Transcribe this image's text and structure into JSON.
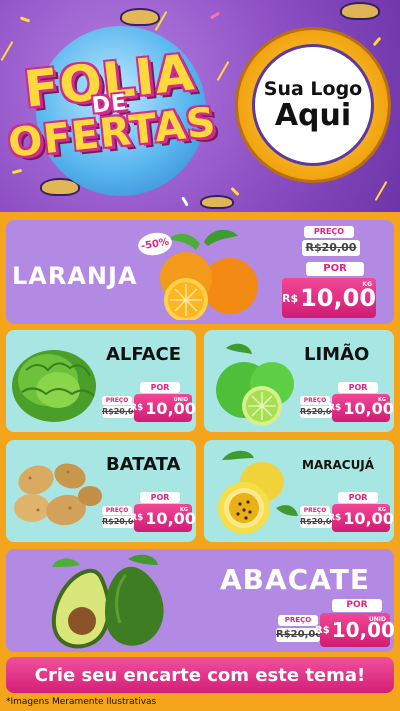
{
  "header": {
    "title_line1": "FOLIA",
    "title_line2": "DE",
    "title_line3": "OFERTAS",
    "logo_line1": "Sua Logo",
    "logo_line2": "Aqui"
  },
  "products": {
    "laranja": {
      "name": "LARANJA",
      "badge": "-50%",
      "price_label": "PREÇO",
      "old_price": "R$20,00",
      "por_label": "POR",
      "currency": "R$",
      "price": "10,00",
      "unit": "KG"
    },
    "alface": {
      "name": "ALFACE",
      "price_label": "PREÇO",
      "old_price": "R$20,00",
      "por_label": "POR",
      "currency": "R$",
      "price": "10,00",
      "unit": "UNID"
    },
    "limao": {
      "name": "LIMÃO",
      "price_label": "PREÇO",
      "old_price": "R$20,00",
      "por_label": "POR",
      "currency": "R$",
      "price": "10,00",
      "unit": "KG"
    },
    "batata": {
      "name": "BATATA",
      "price_label": "PREÇO",
      "old_price": "R$20,00",
      "por_label": "POR",
      "currency": "R$",
      "price": "10,00",
      "unit": "KG"
    },
    "maracuja": {
      "name": "MARACUJÁ",
      "price_label": "PREÇO",
      "old_price": "R$20,00",
      "por_label": "POR",
      "currency": "R$",
      "price": "10,00",
      "unit": "KG"
    },
    "abacate": {
      "name": "ABACATE",
      "price_label": "PREÇO",
      "old_price": "R$20,00",
      "por_label": "POR",
      "currency": "R$",
      "price": "10,00",
      "unit": "UNID"
    }
  },
  "footer": {
    "cta": "Crie seu encarte com este tema!",
    "disclaimer": "*Imagens Meramente Ilustrativas"
  },
  "colors": {
    "purple_panel": "#b28ae3",
    "teal_panel": "#a8e6e4",
    "accent_pink": "#e0257d",
    "background": "#f4a51c"
  }
}
